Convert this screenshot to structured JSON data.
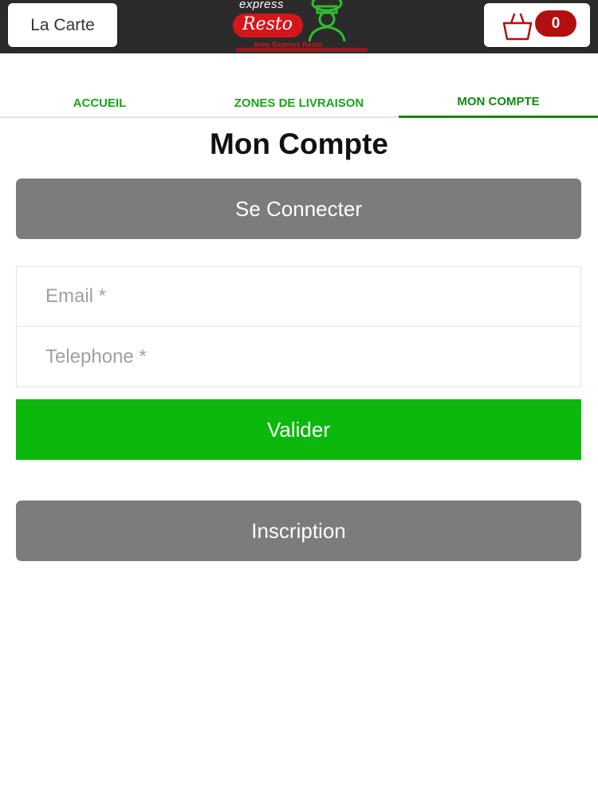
{
  "header": {
    "carte_label": "La Carte",
    "logo": {
      "express": "express",
      "resto": "Resto",
      "tagline": "Avec Express Resto"
    },
    "cart_count": "0",
    "cart_icon": "shopping-basket-icon"
  },
  "nav": {
    "tabs": [
      {
        "label": "ACCUEIL",
        "active": false
      },
      {
        "label": "ZONES DE LIVRAISON",
        "active": false
      },
      {
        "label": "MON COMPTE",
        "active": true
      }
    ]
  },
  "main": {
    "title": "Mon Compte",
    "connect_label": "Se Connecter",
    "form": {
      "email_placeholder": "Email *",
      "telephone_placeholder": "Telephone *"
    },
    "valider_label": "Valider",
    "inscription_label": "Inscription"
  },
  "colors": {
    "topbar": "#2b2b2b",
    "accent_green": "#0cb80c",
    "tab_green": "#19a619",
    "button_gray": "#7d7b7e",
    "badge_red": "#b40f0f"
  }
}
